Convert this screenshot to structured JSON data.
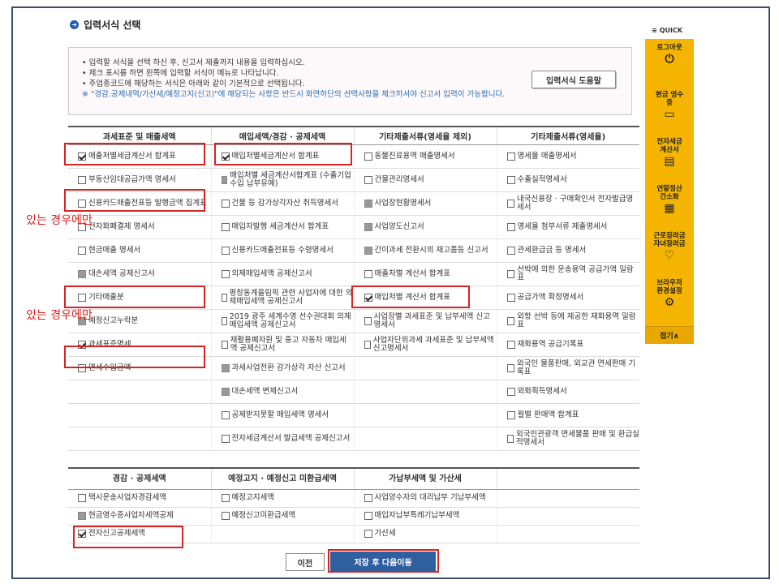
{
  "title": "입력서식 선택",
  "info": {
    "line1": "• 입력할 서식을 선택 하신 후, 신고서 제출까지 내용을 입력하십시오.",
    "line2": "• 체크 표시를 하면 왼쪽에 입력할 서식이 메뉴로 나타납니다.",
    "line3": "• 주업종코드에 해당하는 서식은 아래와 같이 기본적으로 선택됩니다.",
    "note": "※ \"경감.공제내역/가산세/예정고지(신고)\"에 해당되는 사항은 반드시 화면하단의 선택사항을 체크하셔야 신고서 입력이 가능합니다.",
    "help_button": "입력서식 도움말"
  },
  "table1": {
    "headers": [
      "과세표준 및 매출세액",
      "매입세액/경감 · 공제세액",
      "기타제출서류(영세율 제외)",
      "기타제출서류(영세율)"
    ],
    "rows": [
      [
        {
          "t": "매출처별세금계산서 합계표",
          "s": "on"
        },
        {
          "t": "매입처별세금계산서 합계표",
          "s": "on"
        },
        {
          "t": "동물진료용역 매출명세서",
          "s": "off"
        },
        {
          "t": "영세율 매출명세서",
          "s": "off"
        }
      ],
      [
        {
          "t": "부동산임대공급가액 명세서",
          "s": "off"
        },
        {
          "t": "매입처별 세금계산서합계표 (수출기업 수입 납부유예)",
          "s": "dis"
        },
        {
          "t": "건물관리명세서",
          "s": "off"
        },
        {
          "t": "수출실적명세서",
          "s": "off"
        }
      ],
      [
        {
          "t": "신용카드매출전표등 발행금액 집계표",
          "s": "off"
        },
        {
          "t": "건물 등 감가상각자산 취득명세서",
          "s": "off"
        },
        {
          "t": "사업장현황명세서",
          "s": "dis"
        },
        {
          "t": "내국신용장 · 구매확인서 전자발급명세서",
          "s": "off"
        }
      ],
      [
        {
          "t": "전자화폐결제 명세서",
          "s": "off"
        },
        {
          "t": "매입자발행 세금계산서 합계표",
          "s": "off"
        },
        {
          "t": "사업양도신고서",
          "s": "dis"
        },
        {
          "t": "영세율 첨부서류 제출명세서",
          "s": "off"
        }
      ],
      [
        {
          "t": "현금매출 명세서",
          "s": "off"
        },
        {
          "t": "신용카드매출전표등 수령명세서",
          "s": "off"
        },
        {
          "t": "간이과세 전환시의 재고품등 신고서",
          "s": "dis"
        },
        {
          "t": "관세환급금 등 명세서",
          "s": "off"
        }
      ],
      [
        {
          "t": "대손세액 공제신고서",
          "s": "dis"
        },
        {
          "t": "의제매입세액 공제신고서",
          "s": "off"
        },
        {
          "t": "매출처별 계산서 합계표",
          "s": "off"
        },
        {
          "t": "선박에 의한 운송용역 공급가액 일람표",
          "s": "off"
        }
      ],
      [
        {
          "t": "기타매출분",
          "s": "off"
        },
        {
          "t": "평창동계올림픽 관련 사업자에 대한 의제매입세액 공제신고서",
          "s": "off"
        },
        {
          "t": "매입처별 계산서 합계표",
          "s": "on"
        },
        {
          "t": "공급가액 확정명세서",
          "s": "off"
        }
      ],
      [
        {
          "t": "예정신고누락분",
          "s": "dis"
        },
        {
          "t": "2019 광주 세계수영 선수권대회 의제매입세액 공제신고서",
          "s": "off"
        },
        {
          "t": "사업장별 과세표준 및 납부세액 신고명세서",
          "s": "off"
        },
        {
          "t": "외항 선박 등에 제공한 재화용역 일람표",
          "s": "off"
        }
      ],
      [
        {
          "t": "과세표준명세",
          "s": "on"
        },
        {
          "t": "재활용폐자원 및 중고 자동차 매입세액 공제신고서",
          "s": "off"
        },
        {
          "t": "사업자단위과세 과세표준 및 납부세액 신고명세서",
          "s": "off"
        },
        {
          "t": "재화용역 공급기록표",
          "s": "off"
        }
      ],
      [
        {
          "t": "면세수입금액",
          "s": "off"
        },
        {
          "t": "과세사업전환 감가상각 자산 신고서",
          "s": "dis"
        },
        {
          "t": "",
          "s": "none"
        },
        {
          "t": "외국인 물품판매, 외교관 면세판매 기록표",
          "s": "off"
        }
      ],
      [
        {
          "t": "",
          "s": "none"
        },
        {
          "t": "대손세액 변제신고서",
          "s": "dis"
        },
        {
          "t": "",
          "s": "none"
        },
        {
          "t": "외화획득명세서",
          "s": "off"
        }
      ],
      [
        {
          "t": "",
          "s": "none"
        },
        {
          "t": "공제받지못할 매입세액 명세서",
          "s": "off"
        },
        {
          "t": "",
          "s": "none"
        },
        {
          "t": "월별 판매액 합계표",
          "s": "off"
        }
      ],
      [
        {
          "t": "",
          "s": "none"
        },
        {
          "t": "전자세금계산서 발급세액 공제신고서",
          "s": "off"
        },
        {
          "t": "",
          "s": "none"
        },
        {
          "t": "외국인관광객 면세물품 판매 및 환급실적명세서",
          "s": "off"
        }
      ]
    ]
  },
  "table2": {
    "headers": [
      "경감 · 공제세액",
      "예정고지 · 예정신고 미환급세액",
      "가납부세액 및 가산세",
      ""
    ],
    "rows": [
      [
        {
          "t": "택시운송사업자경감세액",
          "s": "off"
        },
        {
          "t": "예정고지세액",
          "s": "off"
        },
        {
          "t": "사업양수자의 대리납부 기납부세액",
          "s": "off"
        },
        {
          "t": "",
          "s": "none"
        }
      ],
      [
        {
          "t": "현금영수증사업자세액공제",
          "s": "dis"
        },
        {
          "t": "예정신고미환급세액",
          "s": "off"
        },
        {
          "t": "매입자납부특례기납부세액",
          "s": "off"
        },
        {
          "t": "",
          "s": "none"
        }
      ],
      [
        {
          "t": "전자신고공제세액",
          "s": "on"
        },
        {
          "t": "",
          "s": "none"
        },
        {
          "t": "가산세",
          "s": "off"
        },
        {
          "t": "",
          "s": "none"
        }
      ]
    ]
  },
  "annotations": {
    "a1": "있는 경우에만",
    "a2": "있는 경우에만"
  },
  "buttons": {
    "prev": "이전",
    "save": "저장 후 다음이동"
  },
  "quick": {
    "header": "QUICK",
    "items": [
      {
        "label": "로그아웃",
        "icon": "logout-icon"
      },
      {
        "label": "현금 영수증",
        "icon": "receipt-icon"
      },
      {
        "label": "전자세금 계산서",
        "icon": "invoice-icon"
      },
      {
        "label": "연말정산 간소화",
        "icon": "calculator-icon"
      },
      {
        "label": "근로장려금 자녀장려금",
        "icon": "heart-hand-icon"
      },
      {
        "label": "브라우저 환경설정",
        "icon": "gear-icon"
      }
    ],
    "fold": "접기∧"
  }
}
